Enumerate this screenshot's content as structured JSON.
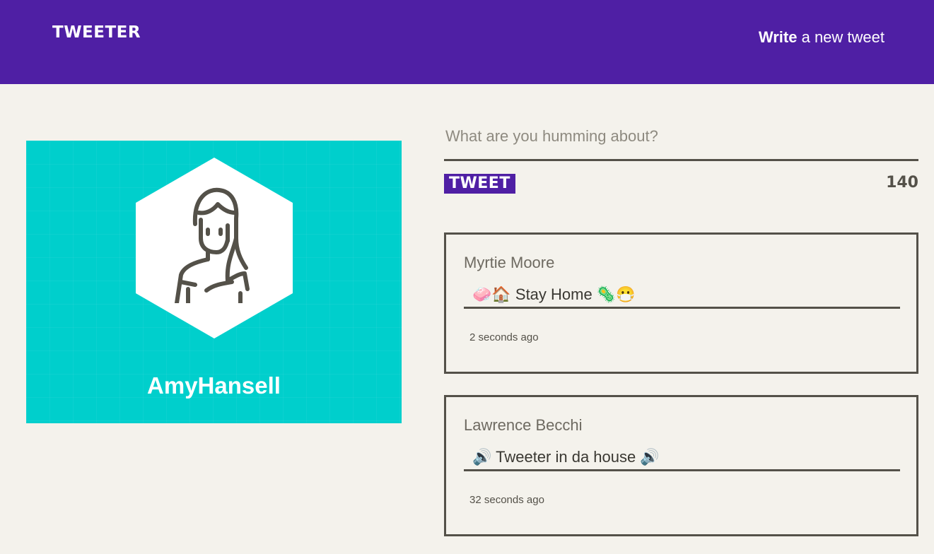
{
  "nav": {
    "brand": "TWEETER",
    "write_bold": "Write",
    "write_rest": " a new tweet"
  },
  "profile": {
    "username": "AmyHansell",
    "avatar_icon": "woman-avatar-icon",
    "background_color": "#00cfcc"
  },
  "composer": {
    "placeholder": "What are you humming about?",
    "button_label": "TWEET",
    "char_count": "140"
  },
  "tweets": [
    {
      "author": "Myrtie Moore",
      "text": "🧼🏠 Stay Home 🦠😷",
      "time": "2 seconds ago"
    },
    {
      "author": "Lawrence Becchi",
      "text": "🔊 Tweeter in da house 🔊",
      "time": "32 seconds ago"
    }
  ],
  "colors": {
    "brand": "#4f1fa4",
    "page_background": "#f4f2ec",
    "ink": "#545149"
  }
}
